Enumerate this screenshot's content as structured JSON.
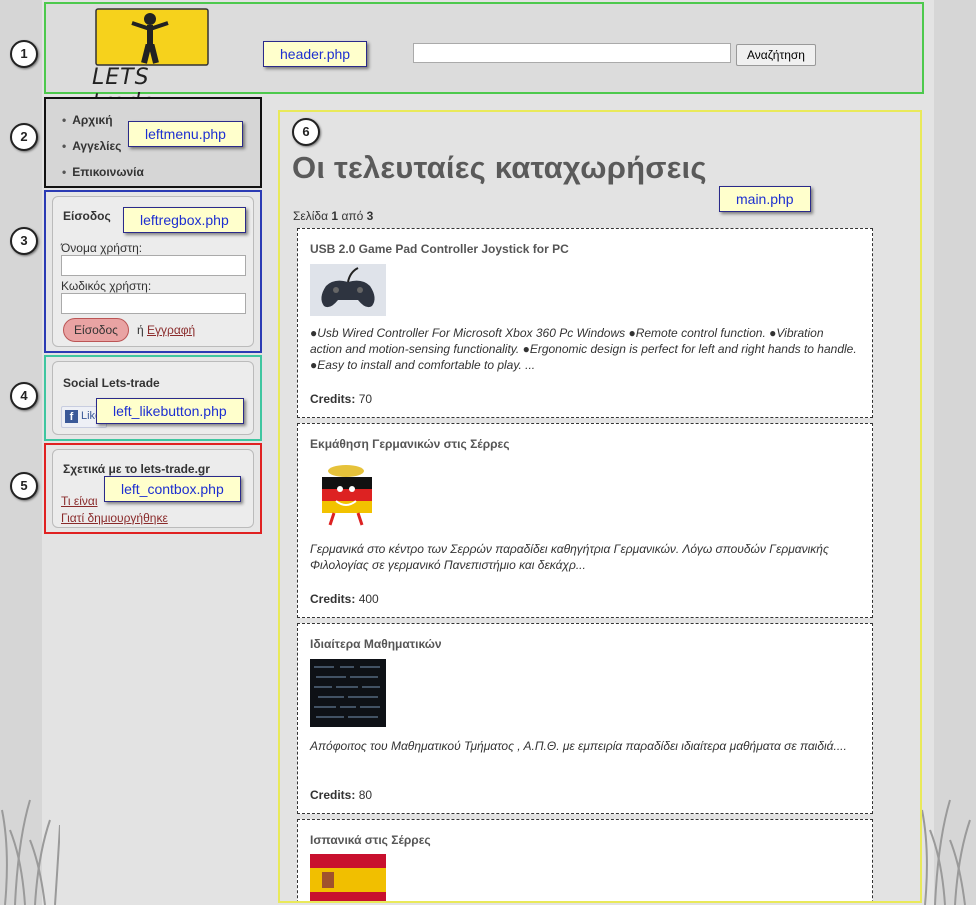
{
  "header": {
    "logo_text": "LETS trade",
    "search_button": "Αναζήτηση",
    "tag": "header.php"
  },
  "markers": [
    "1",
    "2",
    "3",
    "4",
    "5",
    "6"
  ],
  "leftmenu": {
    "items": [
      "Αρχική",
      "Αγγελίες",
      "Επικοινωνία"
    ],
    "tag": "leftmenu.php"
  },
  "regbox": {
    "title": "Είσοδος",
    "username_label": "Όνομα χρήστη:",
    "password_label": "Κωδικός χρήστη:",
    "login_button": "Είσοδος",
    "or": "ή",
    "register_link": "Εγγραφή",
    "tag": "leftregbox.php"
  },
  "likebox": {
    "title": "Social Lets-trade",
    "like_label": "Like",
    "tag": "left_likebutton.php"
  },
  "contbox": {
    "title": "Σχετικά με το lets-trade.gr",
    "link1": "Τι είναι",
    "link2": "Γιατί δημιουργήθηκε",
    "tag": "left_contbox.php"
  },
  "main": {
    "title": "Οι τελευταίες καταχωρήσεις",
    "pager_prefix": "Σελίδα",
    "page_current": "1",
    "pager_mid": "από",
    "page_total": "3",
    "tag": "main.php",
    "credits_label": "Credits:",
    "listings": [
      {
        "title": "USB 2.0 Game Pad Controller Joystick for PC",
        "description": "●Usb Wired Controller For Microsoft Xbox 360 Pc Windows ●Remote control function. ●Vibration action and motion-sensing functionality. ●Ergonomic design is perfect for left and right hands to handle. ●Easy to install and comfortable to play. ...",
        "credits": "70",
        "image": "gamepad-image"
      },
      {
        "title": "Εκμάθηση Γερμανικών στις Σέρρες",
        "description": "Γερμανικά στο κέντρο των Σερρών παραδίδει καθηγήτρια Γερμανικών. Λόγω σπουδών Γερμανικής Φιλολογίας σε γερμανικό Πανεπιστήμιο και δεκάχρ...",
        "credits": "400",
        "image": "german-flag-mascot-image"
      },
      {
        "title": "Ιδιαίτερα Μαθηματικών",
        "description": "Απόφοιτος του Μαθηματικού Τμήματος , Α.Π.Θ. με εμπειρία παραδίδει ιδιαίτερα μαθήματα σε παιδιά....",
        "credits": "80",
        "image": "math-chalkboard-image"
      },
      {
        "title": "Ισπανικά στις Σέρρες",
        "description": "",
        "credits": "",
        "image": "spain-flag-image"
      }
    ]
  },
  "colors": {
    "header_border": "#4dc94d",
    "menu_border": "#111111",
    "regbox_border": "#2b3bb4",
    "likebox_border": "#3fc6a0",
    "contbox_border": "#e02121",
    "main_border": "#e9e95a",
    "tag_bg": "#ffffcc",
    "tag_text": "#1d2fd1"
  }
}
